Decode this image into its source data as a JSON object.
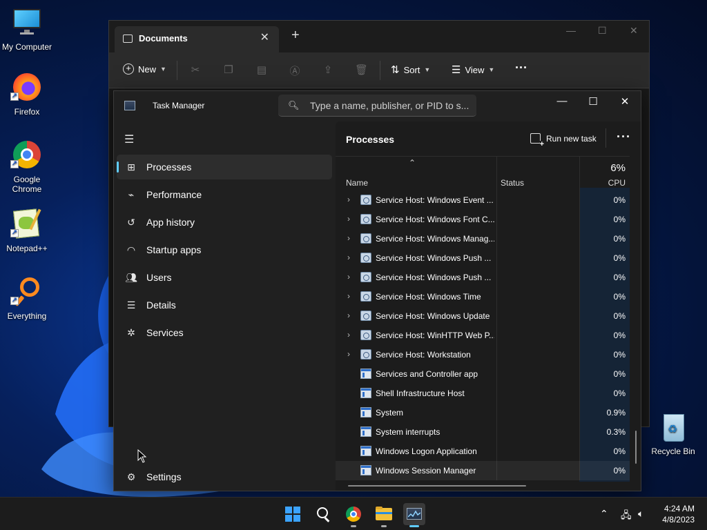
{
  "desktop": {
    "icons": [
      {
        "label": "My Computer",
        "icon": "monitor-icon"
      },
      {
        "label": "Firefox",
        "icon": "firefox-icon"
      },
      {
        "label": "Google Chrome",
        "icon": "chrome-icon"
      },
      {
        "label": "Notepad++",
        "icon": "notepadpp-icon"
      },
      {
        "label": "Everything",
        "icon": "search-magnifier-icon"
      },
      {
        "label": "Recycle Bin",
        "icon": "recycle-bin-icon"
      }
    ]
  },
  "explorer": {
    "tab_title": "Documents",
    "toolbar": {
      "new_label": "New",
      "sort_label": "Sort",
      "view_label": "View"
    }
  },
  "task_manager": {
    "title": "Task Manager",
    "search_placeholder": "Type a name, publisher, or PID to s...",
    "nav": [
      {
        "label": "Processes",
        "icon": "processes-icon",
        "active": true
      },
      {
        "label": "Performance",
        "icon": "performance-icon"
      },
      {
        "label": "App history",
        "icon": "history-icon"
      },
      {
        "label": "Startup apps",
        "icon": "startup-icon"
      },
      {
        "label": "Users",
        "icon": "users-icon"
      },
      {
        "label": "Details",
        "icon": "details-icon"
      },
      {
        "label": "Services",
        "icon": "services-icon"
      }
    ],
    "settings_label": "Settings",
    "page_title": "Processes",
    "run_new_task_label": "Run new task",
    "columns": {
      "name": "Name",
      "status": "Status",
      "cpu_total": "6%",
      "cpu": "CPU"
    },
    "processes": [
      {
        "name": "Service Host: Windows Event ...",
        "cpu": "0%",
        "expandable": true,
        "icon": "gear"
      },
      {
        "name": "Service Host: Windows Font C...",
        "cpu": "0%",
        "expandable": true,
        "icon": "gear"
      },
      {
        "name": "Service Host: Windows Manag...",
        "cpu": "0%",
        "expandable": true,
        "icon": "gear"
      },
      {
        "name": "Service Host: Windows Push ...",
        "cpu": "0%",
        "expandable": true,
        "icon": "gear"
      },
      {
        "name": "Service Host: Windows Push ...",
        "cpu": "0%",
        "expandable": true,
        "icon": "gear"
      },
      {
        "name": "Service Host: Windows Time",
        "cpu": "0%",
        "expandable": true,
        "icon": "gear"
      },
      {
        "name": "Service Host: Windows Update",
        "cpu": "0%",
        "expandable": true,
        "icon": "gear"
      },
      {
        "name": "Service Host: WinHTTP Web P...",
        "cpu": "0%",
        "expandable": true,
        "icon": "gear"
      },
      {
        "name": "Service Host: Workstation",
        "cpu": "0%",
        "expandable": true,
        "icon": "gear"
      },
      {
        "name": "Services and Controller app",
        "cpu": "0%",
        "expandable": false,
        "icon": "win"
      },
      {
        "name": "Shell Infrastructure Host",
        "cpu": "0%",
        "expandable": false,
        "icon": "win"
      },
      {
        "name": "System",
        "cpu": "0.9%",
        "expandable": false,
        "icon": "win"
      },
      {
        "name": "System interrupts",
        "cpu": "0.3%",
        "expandable": false,
        "icon": "win"
      },
      {
        "name": "Windows Logon Application",
        "cpu": "0%",
        "expandable": false,
        "icon": "win"
      },
      {
        "name": "Windows Session Manager",
        "cpu": "0%",
        "expandable": false,
        "icon": "win"
      }
    ]
  },
  "taskbar": {
    "apps": [
      "start-icon",
      "search-icon",
      "chrome-icon",
      "file-explorer-icon",
      "task-manager-icon"
    ],
    "clock": {
      "time": "4:24 AM",
      "date": "4/8/2023"
    }
  },
  "colors": {
    "accent": "#60cdff",
    "cpu_column": "#152436"
  }
}
